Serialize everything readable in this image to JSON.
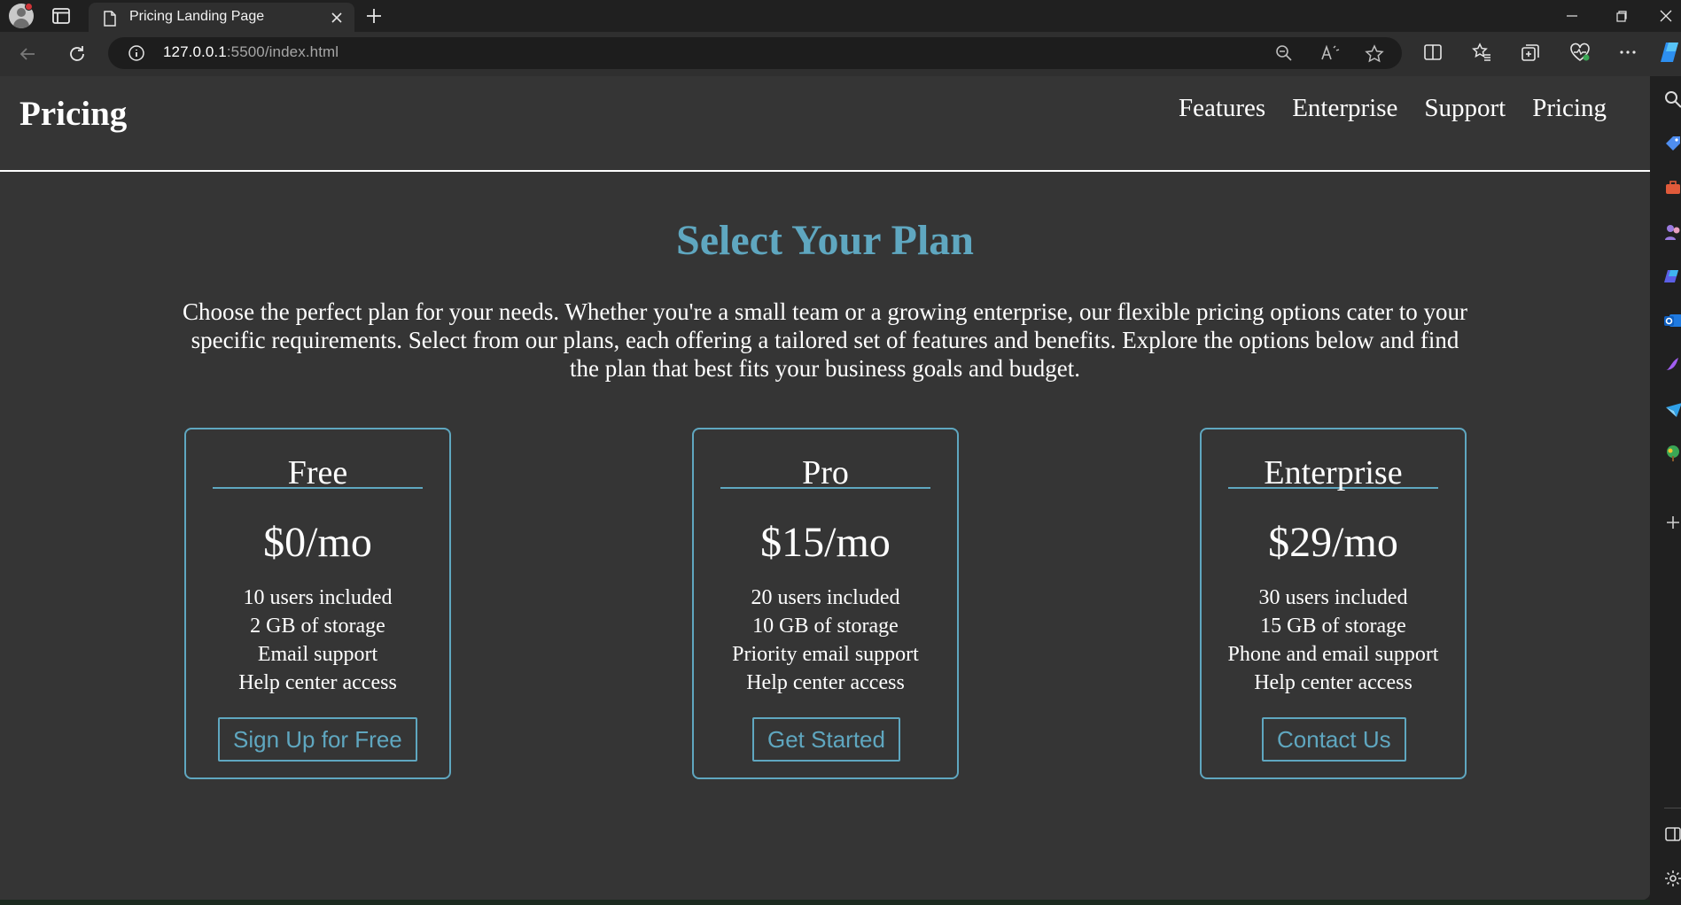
{
  "browser": {
    "tab_title": "Pricing Landing Page",
    "url_host": "127.0.0.1",
    "url_path": ":5500/index.html"
  },
  "site": {
    "logo": "Pricing",
    "nav": [
      "Features",
      "Enterprise",
      "Support",
      "Pricing"
    ]
  },
  "hero": {
    "title": "Select Your Plan",
    "description": "Choose the perfect plan for your needs. Whether you're a small team or a growing enterprise, our flexible pricing options cater to your specific requirements. Select from our plans, each offering a tailored set of features and benefits. Explore the options below and find the plan that best fits your business goals and budget."
  },
  "plans": [
    {
      "name": "Free",
      "price": "$0/mo",
      "features": [
        "10 users included",
        "2 GB of storage",
        "Email support",
        "Help center access"
      ],
      "button": "Sign Up for Free"
    },
    {
      "name": "Pro",
      "price": "$15/mo",
      "features": [
        "20 users included",
        "10 GB of storage",
        "Priority email support",
        "Help center access"
      ],
      "button": "Get Started"
    },
    {
      "name": "Enterprise",
      "price": "$29/mo",
      "features": [
        "30 users included",
        "15 GB of storage",
        "Phone and email support",
        "Help center access"
      ],
      "button": "Contact Us"
    }
  ],
  "colors": {
    "accent": "#5fa7c0",
    "page_background": "#353535",
    "chrome_background": "#202020"
  },
  "icons": {
    "titlebar": [
      "profile-avatar-icon",
      "tab-actions-icon",
      "document-icon",
      "close-icon",
      "plus-icon",
      "minimize-icon",
      "restore-icon",
      "close-window-icon"
    ],
    "toolbar": [
      "back-arrow-icon",
      "refresh-icon",
      "info-icon",
      "zoom-out-icon",
      "read-aloud-icon",
      "favorite-star-icon",
      "split-screen-icon",
      "favorites-icon",
      "collections-icon",
      "browser-essentials-icon",
      "more-icon",
      "copilot-icon"
    ],
    "sidebar": [
      "search-icon",
      "shopping-tag-icon",
      "tools-icon",
      "people-icon",
      "copilot-app-icon",
      "outlook-icon",
      "designer-icon",
      "drop-icon",
      "games-icon",
      "add-icon",
      "sidebar-toggle-icon",
      "settings-gear-icon"
    ]
  }
}
